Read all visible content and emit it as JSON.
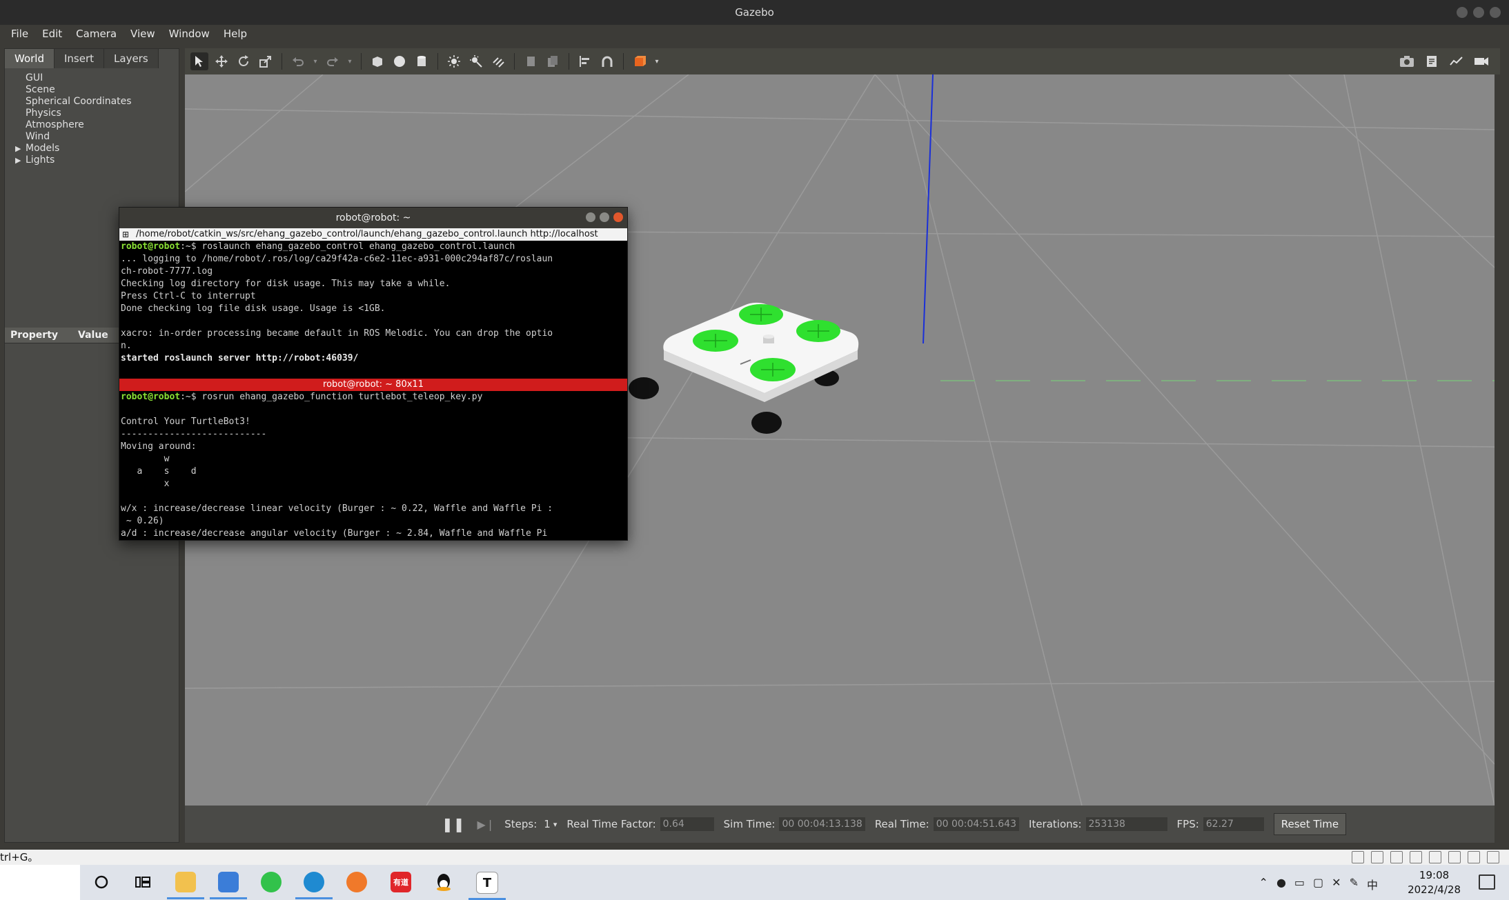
{
  "window": {
    "title": "Gazebo"
  },
  "menu": [
    "File",
    "Edit",
    "Camera",
    "View",
    "Window",
    "Help"
  ],
  "left_panel": {
    "tabs": [
      "World",
      "Insert",
      "Layers"
    ],
    "active_tab": "World",
    "tree": [
      {
        "label": "GUI",
        "expandable": false
      },
      {
        "label": "Scene",
        "expandable": false
      },
      {
        "label": "Spherical Coordinates",
        "expandable": false
      },
      {
        "label": "Physics",
        "expandable": false
      },
      {
        "label": "Atmosphere",
        "expandable": false
      },
      {
        "label": "Wind",
        "expandable": false
      },
      {
        "label": "Models",
        "expandable": true
      },
      {
        "label": "Lights",
        "expandable": true
      }
    ],
    "property_header": {
      "property": "Property",
      "value": "Value"
    }
  },
  "toolbar": {
    "icons": [
      "select-arrow-icon",
      "translate-icon",
      "rotate-icon",
      "scale-icon",
      "undo-icon",
      "redo-icon",
      "box-icon",
      "sphere-icon",
      "cylinder-icon",
      "point-light-icon",
      "spot-light-icon",
      "directional-light-icon",
      "copy-icon",
      "paste-icon",
      "align-icon",
      "snap-icon",
      "view-angle-icon"
    ],
    "right_icons": [
      "screenshot-icon",
      "log-icon",
      "plot-icon",
      "video-record-icon"
    ]
  },
  "status": {
    "steps_label": "Steps:",
    "steps_value": "1",
    "rtf_label": "Real Time Factor:",
    "rtf_value": "0.64",
    "sim_time_label": "Sim Time:",
    "sim_time_value": "00 00:04:13.138",
    "real_time_label": "Real Time:",
    "real_time_value": "00 00:04:51.643",
    "iterations_label": "Iterations:",
    "iterations_value": "253138",
    "fps_label": "FPS:",
    "fps_value": "62.27",
    "reset_button": "Reset Time"
  },
  "hint_strip": {
    "text": "trl+G。"
  },
  "terminal": {
    "title": "robot@robot: ~",
    "tab1_path": "/home/robot/catkin_ws/src/ehang_gazebo_control/launch/ehang_gazebo_control.launch http://localhost",
    "pane1": {
      "prompt": "robot@robot",
      "prompt_suffix": ":~$ ",
      "command": "roslaunch ehang_gazebo_control ehang_gazebo_control.launch",
      "lines": [
        "... logging to /home/robot/.ros/log/ca29f42a-c6e2-11ec-a931-000c294af87c/roslaun",
        "ch-robot-7777.log",
        "Checking log directory for disk usage. This may take a while.",
        "Press Ctrl-C to interrupt",
        "Done checking log file disk usage. Usage is <1GB.",
        "",
        "xacro: in-order processing became default in ROS Melodic. You can drop the optio",
        "n."
      ],
      "bold_line": "started roslaunch server http://robot:46039/"
    },
    "pane2_title": "robot@robot: ~ 80x11",
    "pane2": {
      "prompt": "robot@robot",
      "prompt_suffix": ":~$ ",
      "command": "rosrun ehang_gazebo_function turtlebot_teleop_key.py",
      "lines": [
        "",
        "Control Your TurtleBot3!",
        "---------------------------",
        "Moving around:",
        "        w",
        "   a    s    d",
        "        x",
        "",
        "w/x : increase/decrease linear velocity (Burger : ~ 0.22, Waffle and Waffle Pi :",
        " ~ 0.26)",
        "a/d : increase/decrease angular velocity (Burger : ~ 2.84, Waffle and Waffle Pi"
      ]
    }
  },
  "taskbar": {
    "apps": [
      "cortana-icon",
      "task-view-icon",
      "file-explorer-icon",
      "vmware-icon",
      "wechat-icon",
      "edge-icon",
      "firefox-icon",
      "youdao-icon",
      "qq-icon",
      "typora-icon"
    ],
    "youdao_label": "有道",
    "typora_label": "T",
    "tray_lang": "中",
    "time": "19:08",
    "date": "2022/4/28"
  }
}
